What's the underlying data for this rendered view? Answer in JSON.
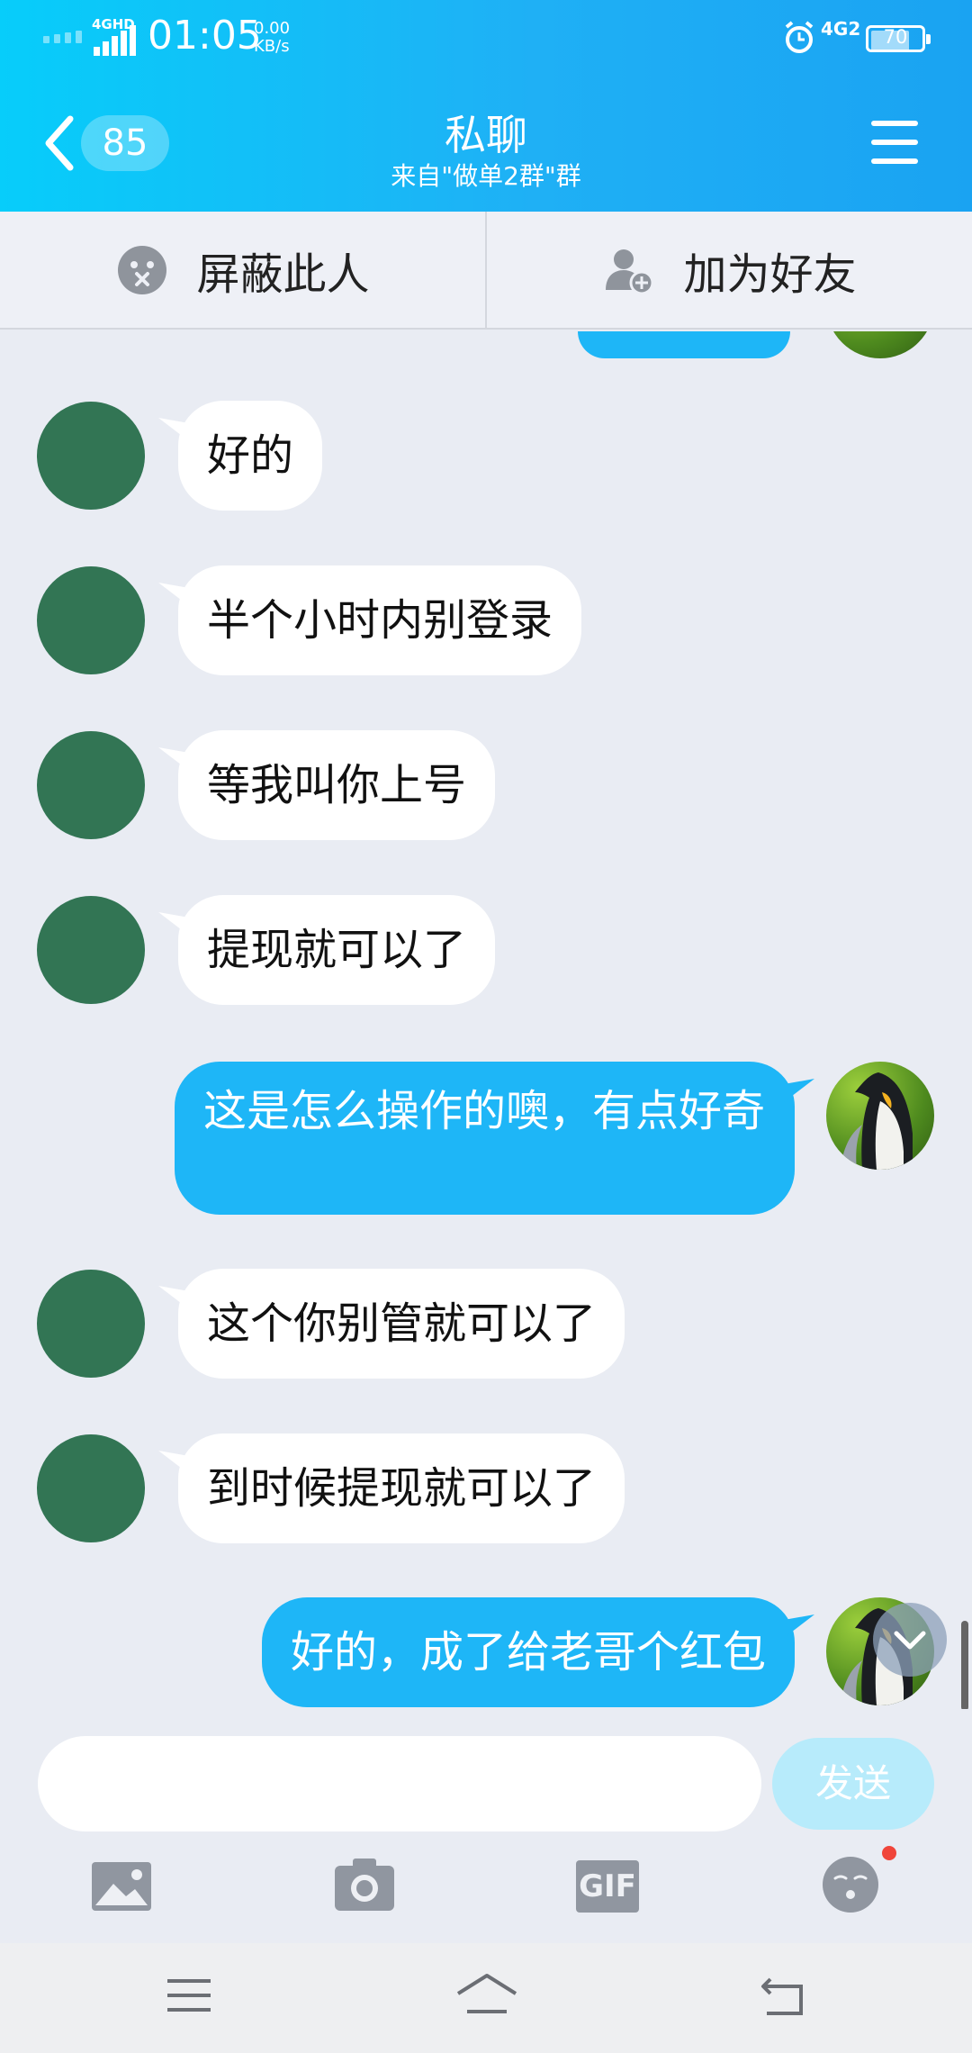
{
  "status_bar": {
    "network_left": "4GHD",
    "time": "01:05",
    "speed_value": "0.00",
    "speed_unit": "KB/s",
    "network_right": "4G2",
    "battery": "70"
  },
  "header": {
    "unread_count": "85",
    "title": "私聊",
    "subtitle": "来自\"做单2群\"群"
  },
  "actions": {
    "block": "屏蔽此人",
    "add_friend": "加为好友"
  },
  "messages": [
    {
      "from": "other",
      "text": "好的"
    },
    {
      "from": "other",
      "text": "半个小时内别登录"
    },
    {
      "from": "other",
      "text": "等我叫你上号"
    },
    {
      "from": "other",
      "text": "提现就可以了"
    },
    {
      "from": "me",
      "text": "这是怎么操作的噢，有点好奇"
    },
    {
      "from": "other",
      "text": "这个你别管就可以了"
    },
    {
      "from": "other",
      "text": "到时候提现就可以了"
    },
    {
      "from": "me",
      "text": "好的，成了给老哥个红包"
    }
  ],
  "input": {
    "value": "",
    "send_label": "发送"
  },
  "toolbar": {
    "gif_label": "GIF"
  },
  "icons": {
    "back": "chevron-left-icon",
    "menu": "hamburger-menu-icon",
    "block": "blocked-face-icon",
    "add_friend": "add-person-icon",
    "image": "image-icon",
    "camera": "camera-icon",
    "gif": "gif-icon",
    "emoji": "emoji-icon"
  },
  "colors": {
    "header_gradient_start": "#07cdfa",
    "header_gradient_end": "#1aa3f2",
    "my_bubble": "#1eb6f7",
    "other_avatar": "#327554",
    "chat_background": "#e9ecf3",
    "send_button": "#b7ebfb"
  }
}
